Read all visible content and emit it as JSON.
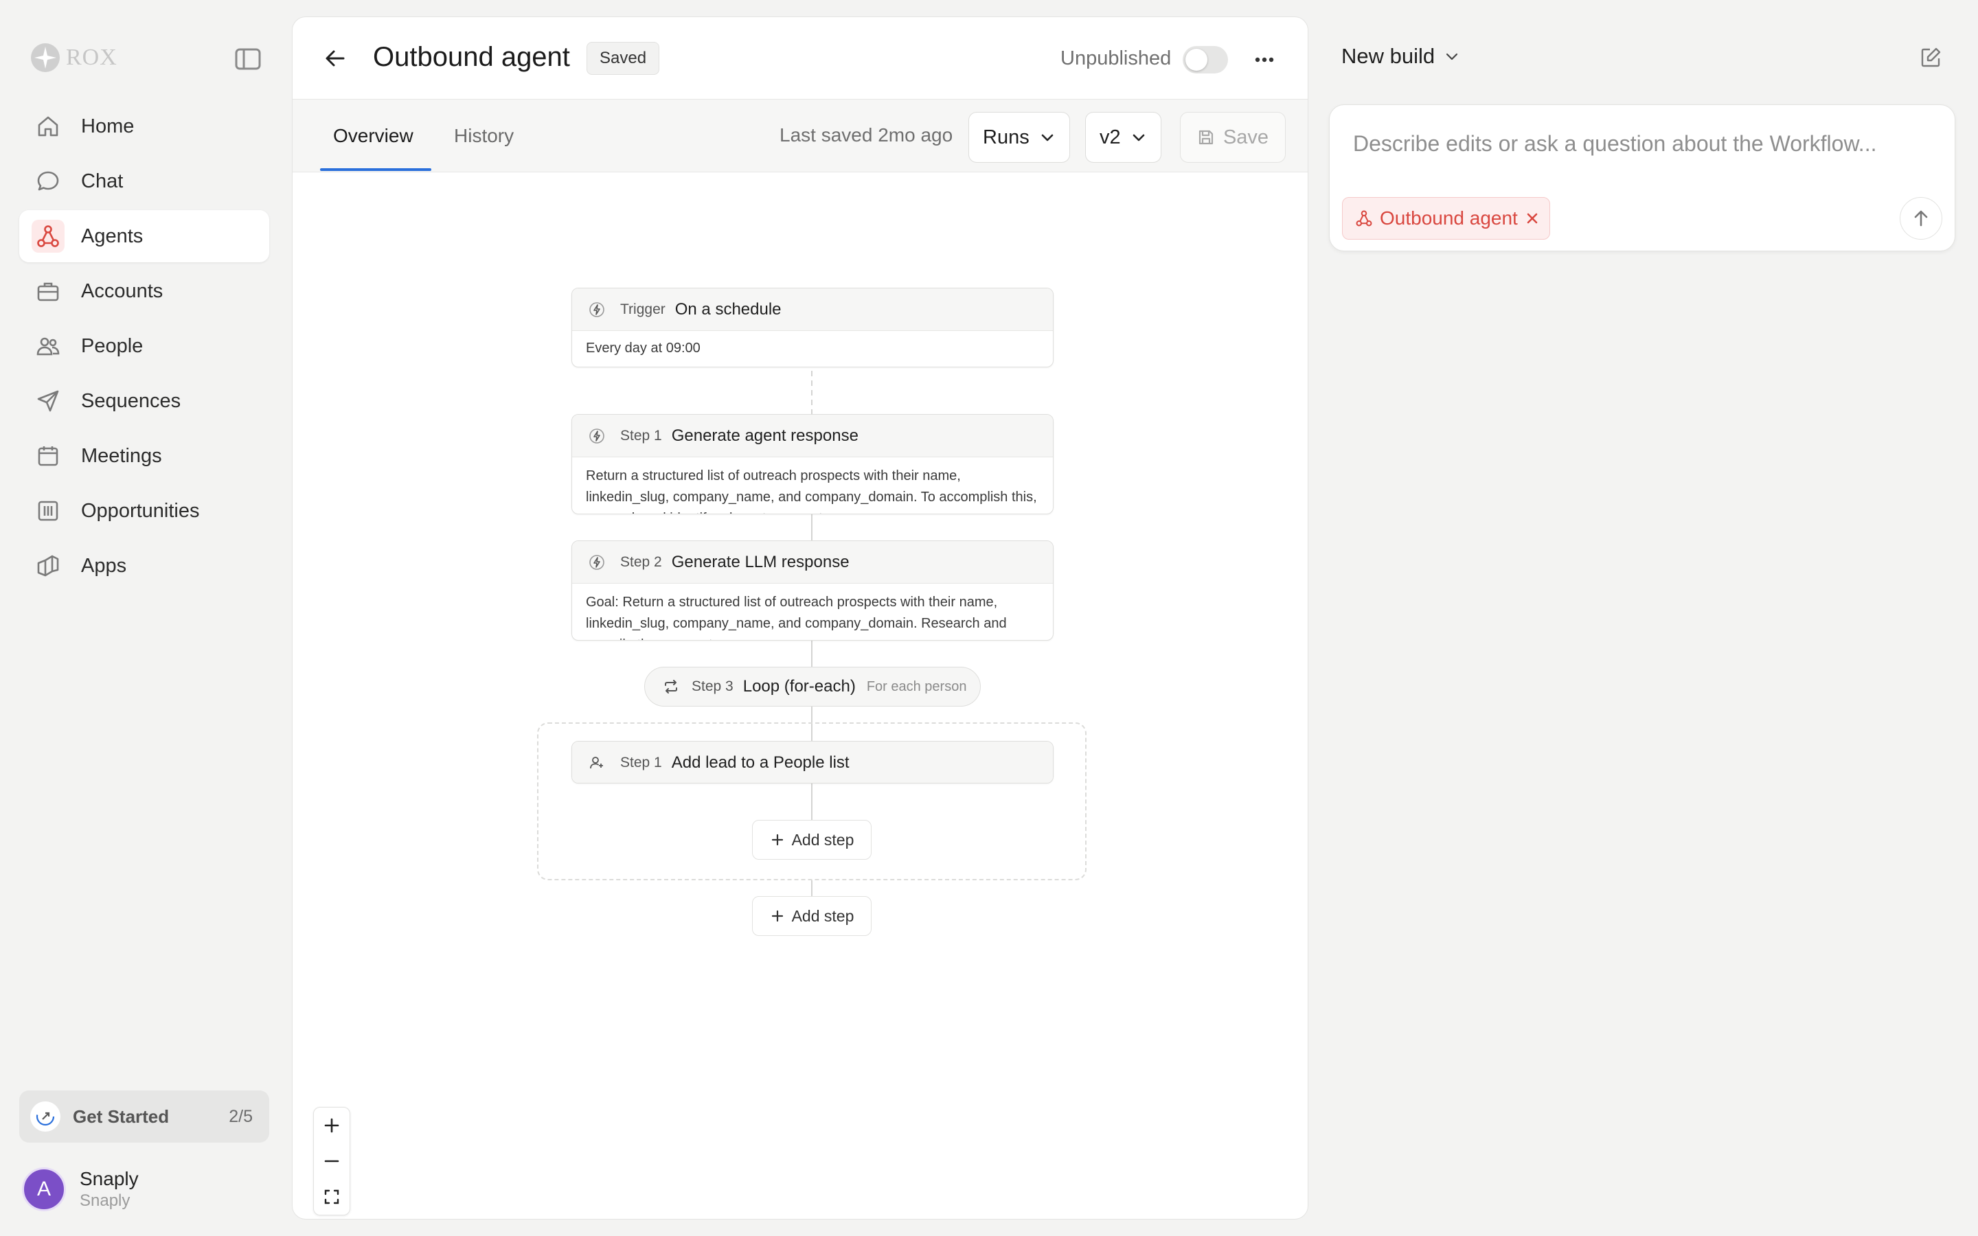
{
  "sidebar": {
    "logo_text": "ROX",
    "items": [
      {
        "label": "Home",
        "icon": "home-icon",
        "active": false
      },
      {
        "label": "Chat",
        "icon": "chat-icon",
        "active": false
      },
      {
        "label": "Agents",
        "icon": "agents-icon",
        "active": true
      },
      {
        "label": "Accounts",
        "icon": "briefcase-icon",
        "active": false
      },
      {
        "label": "People",
        "icon": "people-icon",
        "active": false
      },
      {
        "label": "Sequences",
        "icon": "send-icon",
        "active": false
      },
      {
        "label": "Meetings",
        "icon": "calendar-icon",
        "active": false
      },
      {
        "label": "Opportunities",
        "icon": "columns-icon",
        "active": false
      },
      {
        "label": "Apps",
        "icon": "apps-icon",
        "active": false
      }
    ],
    "get_started": {
      "label": "Get Started",
      "count": "2/5"
    },
    "user": {
      "avatar_letter": "A",
      "name": "Snaply",
      "org": "Snaply"
    }
  },
  "header": {
    "title": "Outbound agent",
    "badge": "Saved",
    "publish_status": "Unpublished"
  },
  "tabs": {
    "items": [
      {
        "label": "Overview",
        "active": true
      },
      {
        "label": "History",
        "active": false
      }
    ],
    "last_saved": "Last saved 2mo ago",
    "runs_label": "Runs",
    "version_label": "v2",
    "save_label": "Save"
  },
  "workflow": {
    "trigger": {
      "kind": "Trigger",
      "title": "On a schedule",
      "desc": "Every day at 09:00"
    },
    "step1": {
      "kind": "Step 1",
      "title": "Generate agent response",
      "desc": "Return a structured list of outreach prospects with their name, linkedin_slug, company_name, and company_domain. To accomplish this, research and identify relevant prospects."
    },
    "step2": {
      "kind": "Step 2",
      "title": "Generate LLM response",
      "desc": "Goal: Return a structured list of outreach prospects with their name, linkedin_slug, company_name, and company_domain. Research and compile the prospects."
    },
    "step3": {
      "kind": "Step 3",
      "title": "Loop (for-each)",
      "sub": "For each person"
    },
    "loop_step1": {
      "kind": "Step 1",
      "title": "Add lead to a People list"
    },
    "add_step_label": "Add step"
  },
  "right_panel": {
    "build_title": "New build",
    "placeholder": "Describe edits or ask a question about the Workflow...",
    "chip_label": "Outbound agent"
  },
  "colors": {
    "accent_blue": "#2a6fdb",
    "agent_red": "#d9473f",
    "avatar_purple": "#7b4fc7"
  }
}
